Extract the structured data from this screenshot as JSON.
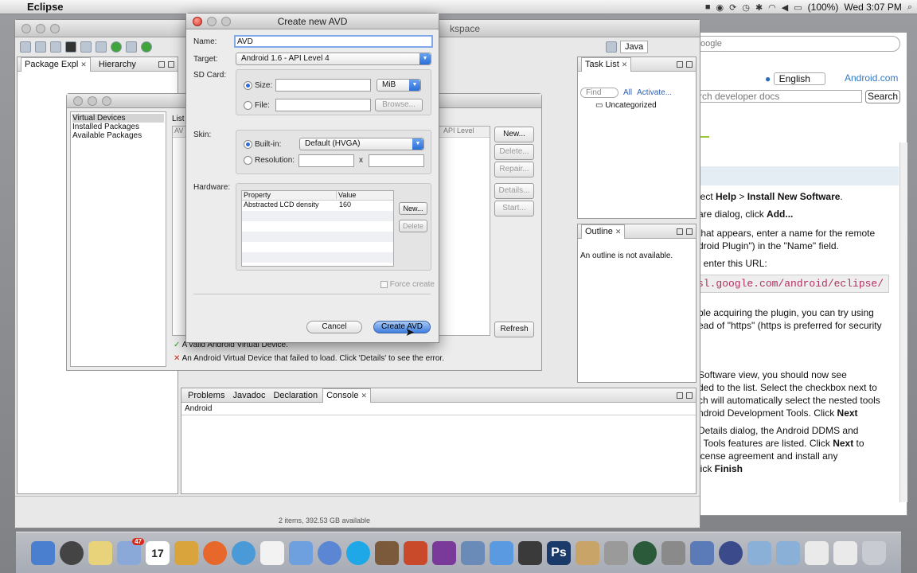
{
  "menubar": {
    "app": "Eclipse",
    "battery": "(100%)",
    "clock": "Wed 3:07 PM"
  },
  "eclipse": {
    "title": "kspace",
    "perspective": "Java",
    "package_explorer_tab": "Package Expl",
    "hierarchy_tab": "Hierarchy",
    "bottom_tabs": [
      "Problems",
      "Javadoc",
      "Declaration",
      "Console"
    ],
    "console_label": "Android"
  },
  "tasklist": {
    "tab": "Task List",
    "find_placeholder": "Find",
    "all": "All",
    "activate": "Activate...",
    "uncategorized": "Uncategorized"
  },
  "outline": {
    "tab": "Outline",
    "message": "An outline is not available."
  },
  "browser": {
    "search_text": "oogle",
    "language": "English",
    "site_link": "Android.com",
    "search_placeholder": "rch developer docs",
    "search_button": "Search",
    "line1_pre": "lect ",
    "line1_help": "Help",
    "line1_mid": " > ",
    "line1_ins": "Install New Software",
    "line1_end": ".",
    "line2_pre": "are dialog, click ",
    "line2_add": "Add...",
    "line3": "that appears, enter a name for the remote",
    "line4": "droid Plugin\") in the \"Name\" field.",
    "line5": ", enter this URL:",
    "url": "sl.google.com/android/eclipse/",
    "line6": "ble acquiring the plugin, you can try using",
    "line7": "ead of \"https\" (https is preferred for security",
    "line8": "Software view, you should now see",
    "line9": "ded to the list. Select the checkbox next to",
    "line10": "ch will automatically select the nested tools",
    "line11_pre": "ndroid Development Tools. Click ",
    "line11_next": "Next",
    "line12": "Details dialog, the Android DDMS and",
    "line13_pre": "t Tools features are listed. Click ",
    "line13_next": "Next",
    "line13_end": " to",
    "line14": "icense agreement and install any",
    "line15_pre": "lick ",
    "line15_finish": "Finish"
  },
  "sdk": {
    "nav": [
      "Virtual Devices",
      "Installed Packages",
      "Available Packages"
    ],
    "list_label": "List",
    "col_av": "AV",
    "col_api": "API Level",
    "buttons": {
      "new": "New...",
      "delete": "Delete...",
      "repair": "Repair...",
      "details": "Details...",
      "start": "Start...",
      "refresh": "Refresh"
    },
    "valid_msg": "A valid Android Virtual Device.",
    "failed_msg": "An Android Virtual Device that failed to load. Click 'Details' to see the error.",
    "status": "2 items, 392.53 GB available"
  },
  "dialog": {
    "title": "Create new AVD",
    "name_label": "Name:",
    "name_value": "AVD",
    "target_label": "Target:",
    "target_value": "Android 1.6 - API Level 4",
    "sdcard_label": "SD Card:",
    "size_label": "Size:",
    "size_unit": "MiB",
    "file_label": "File:",
    "browse": "Browse...",
    "skin_label": "Skin:",
    "builtin_label": "Built-in:",
    "builtin_value": "Default (HVGA)",
    "resolution_label": "Resolution:",
    "res_x": "x",
    "hardware_label": "Hardware:",
    "col_property": "Property",
    "col_value": "Value",
    "hw_property": "Abstracted LCD density",
    "hw_value": "160",
    "hw_new": "New...",
    "hw_delete": "Delete",
    "force_create": "Force create",
    "cancel": "Cancel",
    "create": "Create AVD"
  },
  "dock": {
    "calendar_day": "17",
    "badge": "47"
  }
}
